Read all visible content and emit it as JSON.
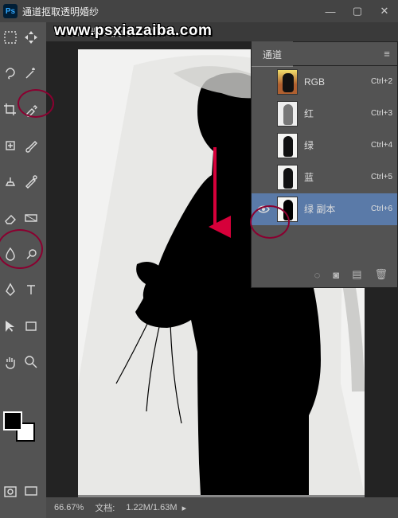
{
  "window": {
    "title": "通道抠取透明婚纱"
  },
  "watermark": "www.psxiazaiba.com",
  "doc_tab": "——替换背景 .jpg @ 66.7%(绿",
  "channels": {
    "tab": "通道",
    "items": [
      {
        "name": "RGB",
        "shortcut": "Ctrl+2",
        "visible": false,
        "selected": false
      },
      {
        "name": "红",
        "shortcut": "Ctrl+3",
        "visible": false,
        "selected": false
      },
      {
        "name": "绿",
        "shortcut": "Ctrl+4",
        "visible": false,
        "selected": false
      },
      {
        "name": "蓝",
        "shortcut": "Ctrl+5",
        "visible": false,
        "selected": false
      },
      {
        "name": "绿 副本",
        "shortcut": "Ctrl+6",
        "visible": true,
        "selected": true
      }
    ]
  },
  "status": {
    "zoom": "66.67%",
    "doc_label": "文档:",
    "doc_vals": "1.22M/1.63M"
  },
  "colors": {
    "annot": "#8a0030"
  }
}
